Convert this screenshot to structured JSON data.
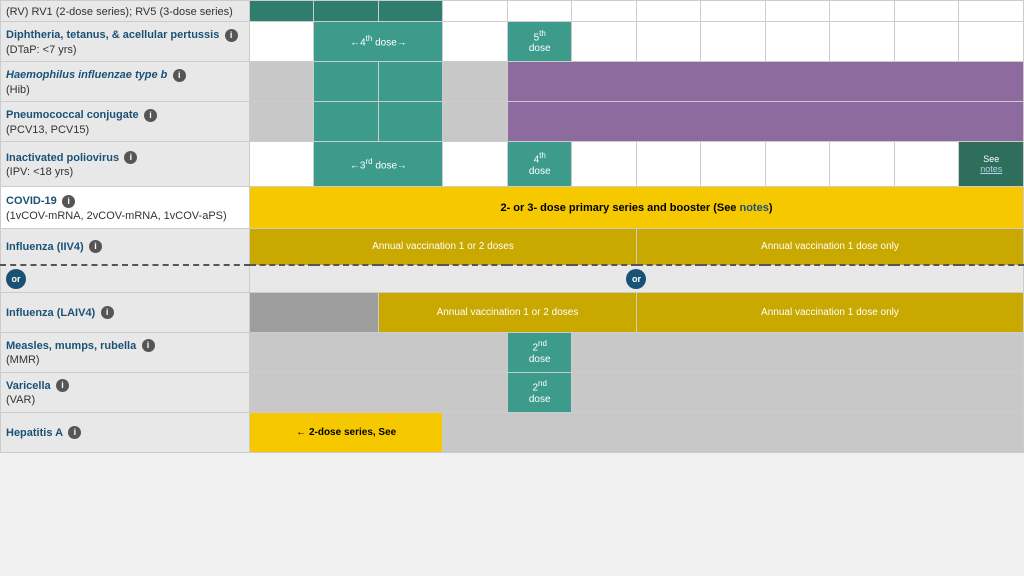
{
  "vaccines": [
    {
      "id": "rv",
      "name": "(RV) RV1 (2-dose series); RV5 (3-dose series)",
      "italic": false,
      "link": false,
      "sub": "",
      "info": false
    },
    {
      "id": "dtap",
      "name": "Diphtheria, tetanus, & acellular pertussis",
      "italic": false,
      "link": true,
      "sub": "(DTaP: <7 yrs)",
      "info": true,
      "doses": {
        "arrow4": "←4th dose→",
        "dose5": "5th dose"
      }
    },
    {
      "id": "hib",
      "name": "Haemophilus influenzae type b",
      "italic": true,
      "link": true,
      "sub": "(Hib)",
      "info": true
    },
    {
      "id": "pcv",
      "name": "Pneumococcal conjugate",
      "italic": false,
      "link": true,
      "sub": "(PCV13, PCV15)",
      "info": true
    },
    {
      "id": "ipv",
      "name": "Inactivated poliovirus",
      "italic": false,
      "link": true,
      "sub": "(IPV: <18 yrs)",
      "info": true,
      "doses": {
        "arrow3": "←3rd dose→",
        "dose4": "4th dose",
        "seenotes": "See notes"
      }
    },
    {
      "id": "covid",
      "name": "COVID-19",
      "italic": false,
      "link": true,
      "sub": "(1vCOV-mRNA, 2vCOV-mRNA, 1vCOV-aPS)",
      "info": true,
      "text": "2- or 3- dose primary series and booster (See notes)"
    },
    {
      "id": "influenza-iiv4",
      "name": "Influenza (IIV4)",
      "italic": false,
      "link": true,
      "sub": "",
      "info": true,
      "annual1": "Annual vaccination 1 or 2 doses",
      "annual2": "Annual vaccination 1 dose only"
    },
    {
      "id": "or-label",
      "name": "or",
      "italic": false,
      "link": false,
      "sub": "",
      "info": false
    },
    {
      "id": "influenza-laiv4",
      "name": "Influenza (LAIV4)",
      "italic": false,
      "link": true,
      "sub": "",
      "info": true,
      "annual1": "Annual vaccination 1 or 2 doses",
      "annual2": "Annual vaccination 1 dose only"
    },
    {
      "id": "mmr",
      "name": "Measles, mumps, rubella",
      "italic": false,
      "link": true,
      "sub": "(MMR)",
      "info": true,
      "dose2": "2nd dose"
    },
    {
      "id": "varicella",
      "name": "Varicella",
      "italic": false,
      "link": true,
      "sub": "(VAR)",
      "info": true,
      "dose2": "2nd dose"
    },
    {
      "id": "hepa",
      "name": "Hepatitis A",
      "italic": false,
      "link": true,
      "sub": "",
      "info": true,
      "dose_text": "← 2-dose series, See"
    }
  ],
  "labels": {
    "or": "or",
    "notes": "notes"
  }
}
